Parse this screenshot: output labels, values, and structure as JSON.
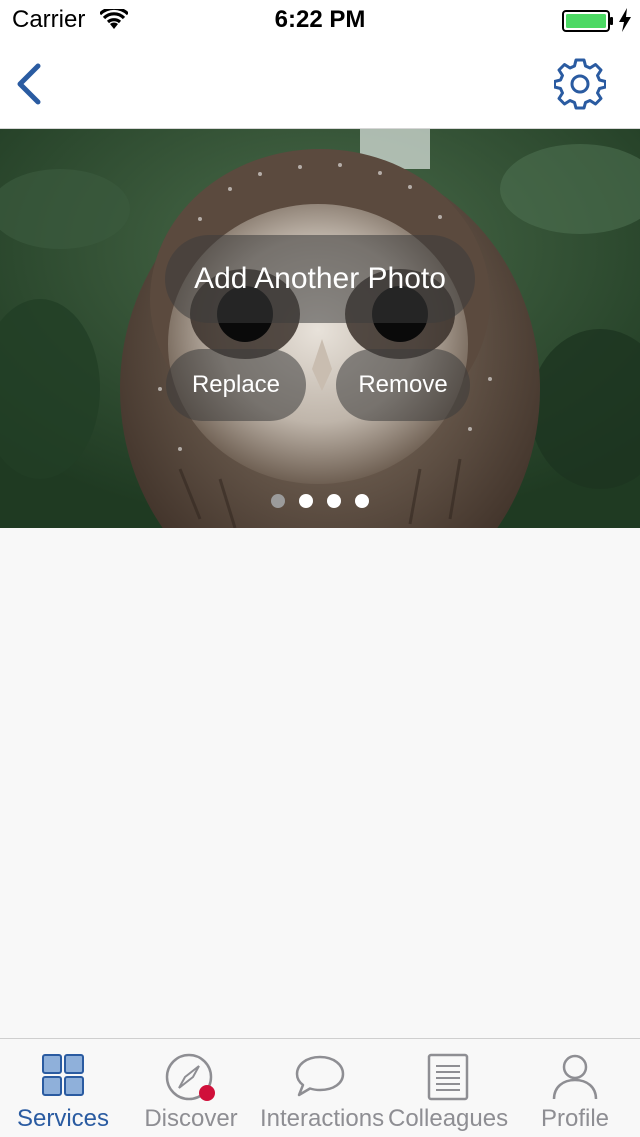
{
  "status_bar": {
    "carrier": "Carrier",
    "time": "6:22 PM",
    "battery_color": "#4cd964"
  },
  "nav": {
    "back_icon": "chevron-left-icon",
    "settings_icon": "gear-icon",
    "tint": "#2a5ba1"
  },
  "photo": {
    "subject": "owl",
    "actions": {
      "add_label": "Add Another Photo",
      "replace_label": "Replace",
      "remove_label": "Remove"
    },
    "page_count": 4,
    "current_page": 1
  },
  "tab_bar": {
    "active_color": "#2a5ba1",
    "inactive_color": "#8e8e93",
    "badge_color": "#d0103a",
    "items": [
      {
        "label": "Services",
        "icon": "grid-icon",
        "active": true
      },
      {
        "label": "Discover",
        "icon": "compass-icon",
        "active": false,
        "badge": true
      },
      {
        "label": "Interactions",
        "icon": "speech-bubble-icon",
        "active": false
      },
      {
        "label": "Colleagues",
        "icon": "document-list-icon",
        "active": false
      },
      {
        "label": "Profile",
        "icon": "person-icon",
        "active": false
      }
    ]
  }
}
